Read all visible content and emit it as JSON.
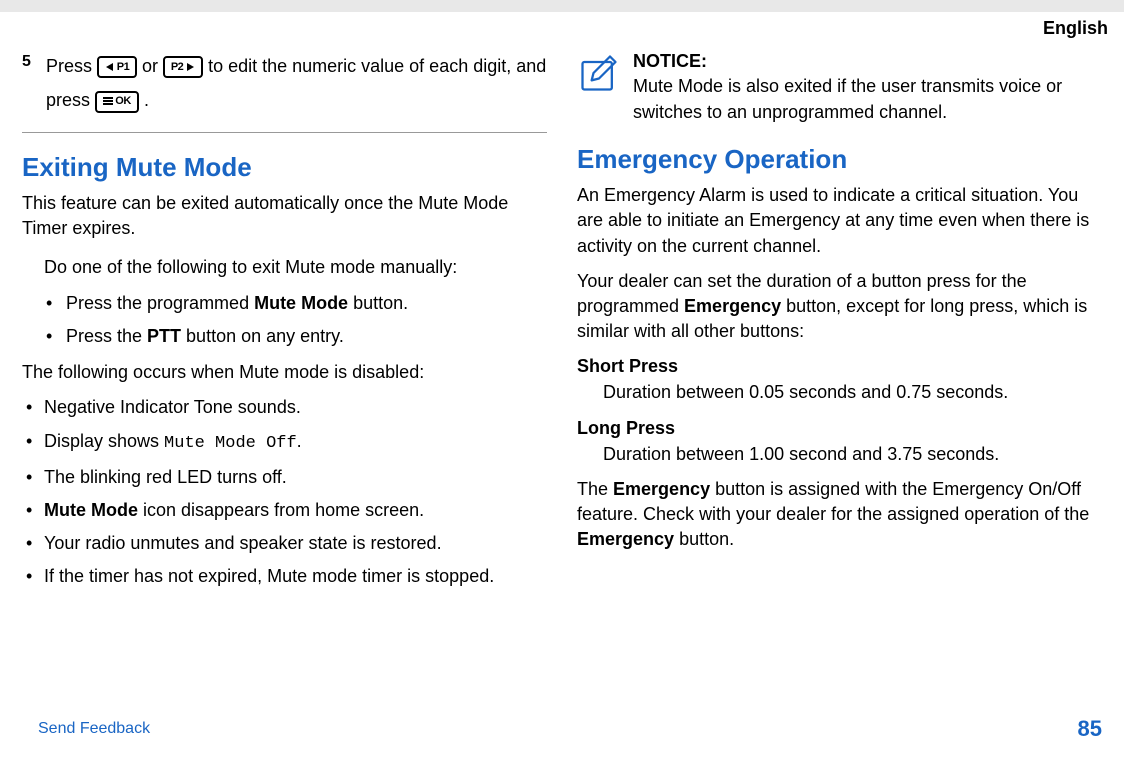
{
  "lang": "English",
  "step": {
    "num": "5",
    "text_pre": "Press ",
    "text_or": " or ",
    "text_mid": " to edit the numeric value of each digit, and press ",
    "text_end": ".",
    "key_p1": "P1",
    "key_p2": "P2",
    "key_ok": "OK"
  },
  "left": {
    "h_exiting": "Exiting Mute Mode",
    "p_feature": "This feature can be exited automatically once the Mute Mode Timer expires.",
    "p_manual": "Do one of the following to exit Mute mode manually:",
    "li_mute_pre": "Press the programmed ",
    "li_mute_bold": "Mute Mode",
    "li_mute_post": " button.",
    "li_ptt_pre": "Press the ",
    "li_ptt_bold": "PTT",
    "li_ptt_post": " button on any entry.",
    "p_disabled": "The following occurs when Mute mode is disabled:",
    "li_neg": "Negative Indicator Tone sounds.",
    "li_disp_pre": "Display shows ",
    "li_disp_mono": "Mute Mode Off",
    "li_disp_post": ".",
    "li_led": "The blinking red LED turns off.",
    "li_icon_bold": "Mute Mode",
    "li_icon_post": " icon disappears from home screen.",
    "li_unmute": "Your radio unmutes and speaker state is restored.",
    "li_timer": "If the timer has not expired, Mute mode timer is stopped."
  },
  "right": {
    "notice_title": "NOTICE:",
    "notice_body": "Mute Mode is also exited if the user transmits voice or switches to an unprogrammed channel.",
    "h_emergency": "Emergency Operation",
    "p_alarm": "An Emergency Alarm is used to indicate a critical situation. You are able to initiate an Emergency at any time even when there is activity on the current channel.",
    "p_dealer_pre": "Your dealer can set the duration of a button press for the programmed ",
    "p_dealer_bold": "Emergency",
    "p_dealer_post": " button, except for long press, which is similar with all other buttons:",
    "short_term": "Short Press",
    "short_desc": "Duration between 0.05 seconds and 0.75 seconds.",
    "long_term": "Long Press",
    "long_desc": "Duration between 1.00 second and 3.75 seconds.",
    "p_assign_pre": "The ",
    "p_assign_b1": "Emergency",
    "p_assign_mid": " button is assigned with the Emergency On/Off feature. Check with your dealer for the assigned operation of the ",
    "p_assign_b2": "Emergency",
    "p_assign_post": " button."
  },
  "footer": {
    "feedback": "Send Feedback",
    "page": "85"
  }
}
